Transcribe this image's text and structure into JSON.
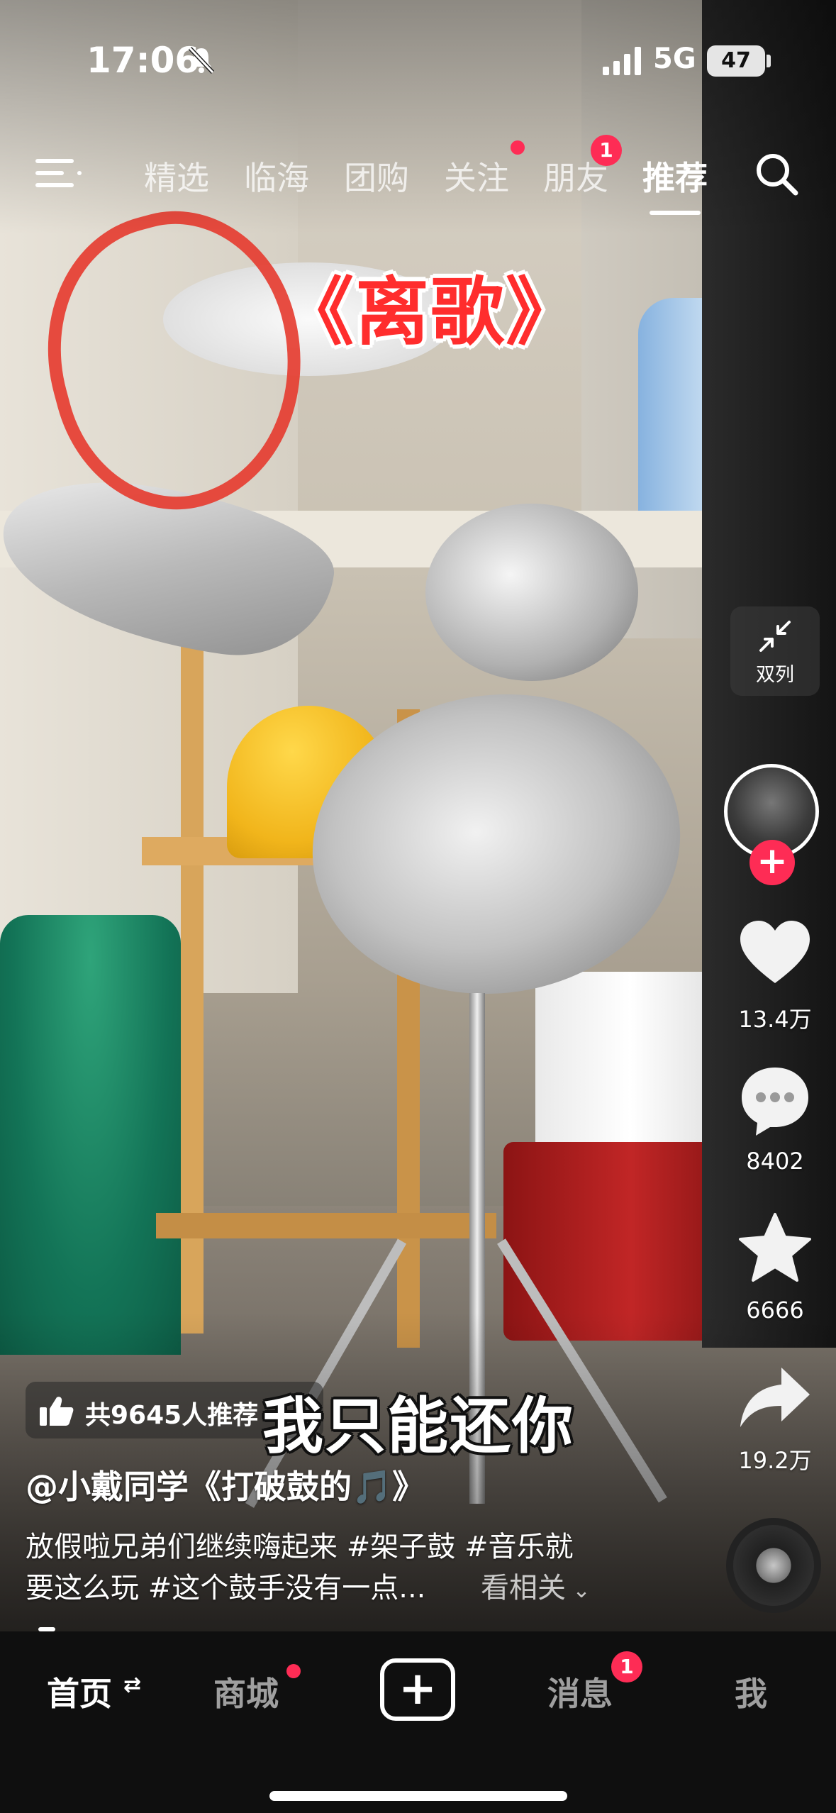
{
  "status_bar": {
    "time": "17:06",
    "network": "5G",
    "battery": "47"
  },
  "top_nav": {
    "tabs": [
      {
        "label": "精选"
      },
      {
        "label": "临海"
      },
      {
        "label": "团购"
      },
      {
        "label": "关注"
      },
      {
        "label": "朋友"
      },
      {
        "label": "推荐"
      }
    ],
    "active_tab": "推荐",
    "friends_badge": "1"
  },
  "overlay": {
    "song_title": "《离歌》",
    "subtitle": "我只能还你"
  },
  "right_rail": {
    "dual_label": "双列",
    "likes": "13.4万",
    "comments": "8402",
    "favorites": "6666",
    "shares": "19.2万"
  },
  "info": {
    "recommend": "共9645人推荐",
    "author": "@小戴同学《打破鼓的🎵》",
    "description_line1": "放假啦兄弟们继续嗨起来 #架子鼓 #音乐就",
    "description_line2": "要这么玩 #这个鼓手没有一点...",
    "see_related": "看相关"
  },
  "bottom_tabs": {
    "home": "首页",
    "mall": "商城",
    "messages": "消息",
    "me": "我",
    "messages_badge": "1"
  },
  "colors": {
    "accent": "#fe2c55",
    "title_red": "#ff2d2d"
  }
}
